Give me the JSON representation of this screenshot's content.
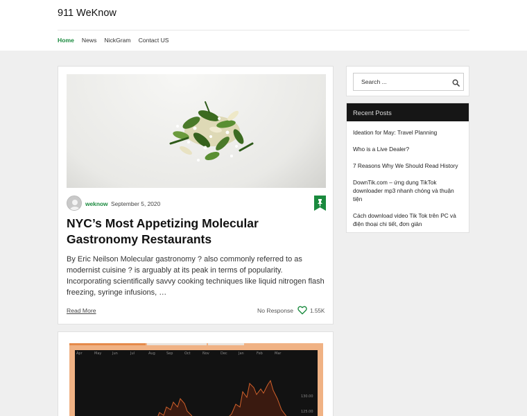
{
  "site": {
    "title": "911 WeKnow"
  },
  "nav": {
    "items": [
      "Home",
      "News",
      "NickGram",
      "Contact US"
    ],
    "active": "Home"
  },
  "post": {
    "image_alt": "Plated molecular gastronomy dish with herbs and flowers",
    "author": "weknow",
    "date": "September 5, 2020",
    "title": "NYC’s Most Appetizing Molecular Gastronomy Restaurants",
    "excerpt": "By Eric Neilson Molecular gastronomy ? also commonly referred to as modernist cuisine ? is arguably at its peak in terms of popularity. Incorporating scientifically savvy cooking techniques like liquid nitrogen flash freezing, syringe infusions, …",
    "read_more": "Read More",
    "response": "No Response",
    "likes": "1.55K"
  },
  "second_post": {
    "chart_thumbnail": {
      "months": [
        "Apr",
        "May",
        "Jun",
        "Jul",
        "Aug",
        "Sep",
        "Oct",
        "Nov",
        "Dec",
        "Jan",
        "Feb",
        "Mar"
      ],
      "price_labels": [
        "130.00",
        "125.00"
      ]
    }
  },
  "sidebar": {
    "search": {
      "placeholder": "Search ..."
    },
    "recent": {
      "title": "Recent Posts",
      "items": [
        "Ideation for May: Travel Planning",
        "Who is a Live Dealer?",
        "7 Reasons Why We Should Read History",
        "DownTik.com – ứng dụng TikTok downloader mp3 nhanh chóng và thuận tiện",
        "Cách download video Tik Tok trên PC và điện thoại chi tiết, đơn giản"
      ]
    }
  },
  "colors": {
    "accent": "#1a8a3e",
    "recent_header_bg": "#161616",
    "page_bg": "#efefef"
  }
}
